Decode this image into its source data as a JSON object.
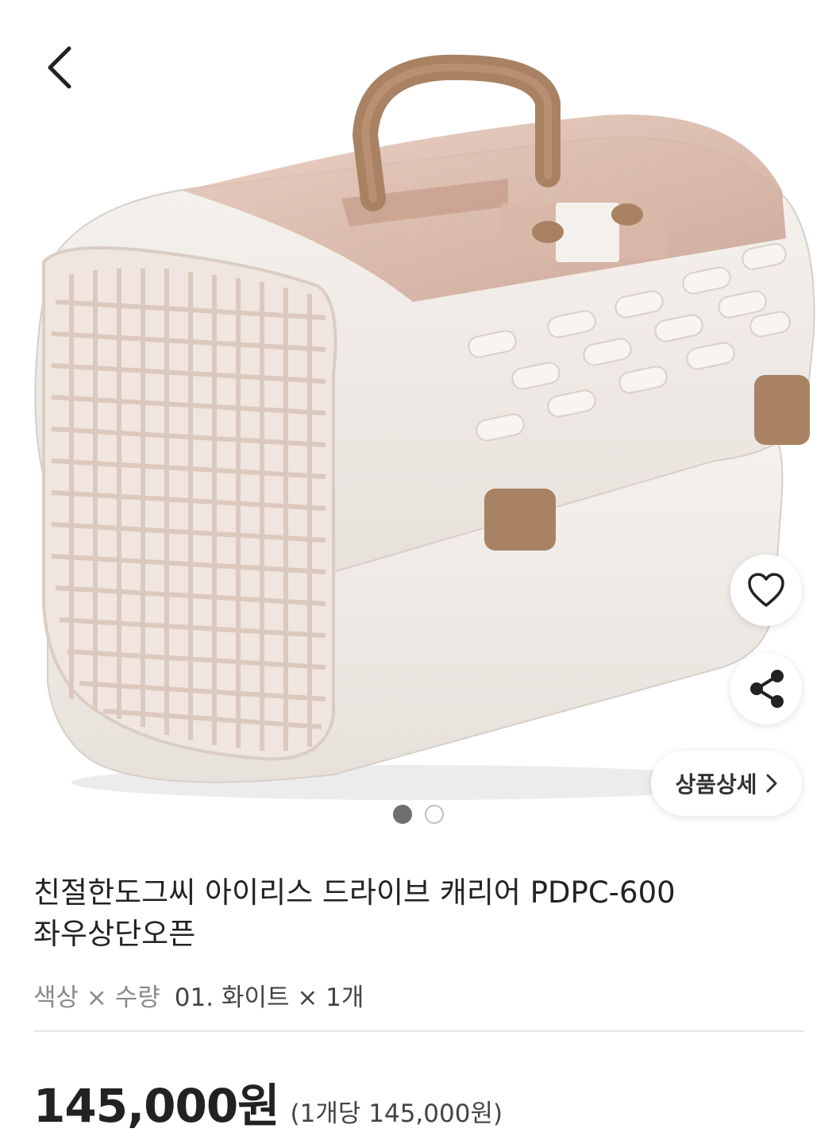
{
  "header": {
    "back_icon": "chevron-left-icon"
  },
  "actions": {
    "wish_icon": "heart-outline-icon",
    "share_icon": "share-icon",
    "detail_label": "상품상세",
    "detail_icon": "chevron-right-icon"
  },
  "carousel": {
    "total": 2,
    "current": 1
  },
  "product": {
    "title_line1": "친절한도그씨 아이리스 드라이브 캐리어 PDPC-600",
    "title_line2": "좌우상단오픈",
    "option_keys": "색상 × 수량",
    "option_values": "01. 화이트 × 1개",
    "price": "145,000원",
    "unit_price": "(1개당 145,000원)"
  },
  "colors": {
    "accent_brown": "#a88262",
    "body_white": "#f1ece7",
    "lid_pink": "#d8b6a6"
  }
}
